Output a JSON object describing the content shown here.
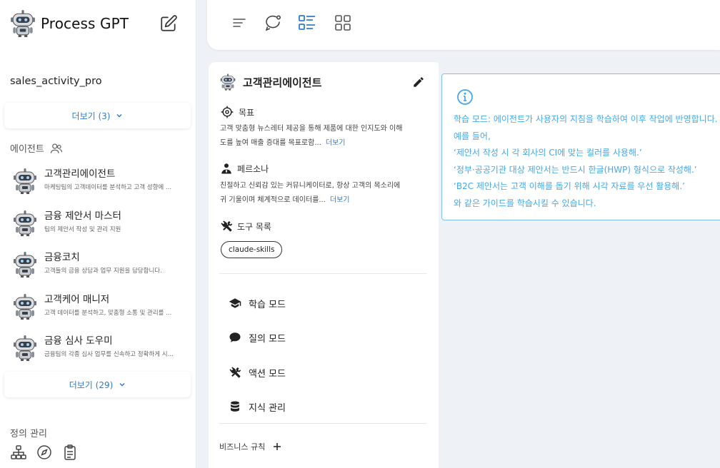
{
  "app": {
    "title": "Process GPT"
  },
  "sidebar": {
    "project_name": "sales_activity_pro",
    "more_projects": "더보기 (3)",
    "agents_label": "에이전트",
    "agents": [
      {
        "name": "고객관리에이전트",
        "desc": "마케팅팀의 고객데이터를 분석하고 고객 성향에 ..."
      },
      {
        "name": "금융 제안서 마스터",
        "desc": "팀의 제안서 작성 및 관리 지원"
      },
      {
        "name": "금융코치",
        "desc": "고객들의 금융 상담과 업무 지원을 담당합니다."
      },
      {
        "name": "고객케어 매니저",
        "desc": "고객 데이터를 분석하고, 맞춤형 소통 및 관리를 ..."
      },
      {
        "name": "금융 심사 도우미",
        "desc": "금융팀의 각종 심사 업무를 신속하고 정확하게 시..."
      }
    ],
    "more_agents": "더보기 (29)",
    "definition_label": "정의 관리"
  },
  "toolbar": {
    "icons": [
      "menu-icon",
      "chat-icon",
      "list-detail-icon",
      "grid-icon"
    ]
  },
  "agent_panel": {
    "title": "고객관리에이전트",
    "goal_label": "목표",
    "goal_line1": "고객 맞춤형 뉴스레터 제공을 통해 제품에 대한 인지도와 이해",
    "goal_line2": "도를 높여 매출 증대를 목표로함...",
    "goal_more": "더보기",
    "persona_label": "페르소나",
    "persona_line1": "친절하고 신뢰감 있는 커뮤니케이터로, 항상 고객의 목소리에",
    "persona_line2": "귀 기울이며 체계적으로 데이터를...",
    "persona_more": "더보기",
    "tools_label": "도구 목록",
    "tool_chip": "claude-skills",
    "modes": {
      "learn": "학습 모드",
      "query": "질의 모드",
      "action": "액션 모드",
      "knowledge": "지식 관리"
    },
    "business_rules": "비즈니스 규칙"
  },
  "info_card": {
    "lines": [
      "학습 모드: 에이전트가 사용자의 지침을 학습하여 이후 작업에 반영합니다.",
      "예를 들어,",
      "‘제안서 작성 시 각 회사의 CI에 맞는 컬러를 사용해.’",
      "‘정부·공공기관 대상 제안서는 반드시 한글(HWP) 형식으로 작성해.’",
      "‘B2C 제안서는 고객 이해를 돕기 위해 시각 자료를 우선 활용해.’",
      "와 같은 가이드를 학습시킬 수 있습니다."
    ]
  },
  "colors": {
    "accent": "#2f7dd1",
    "info": "#45a8ea",
    "info_border": "#7cc1ee",
    "background": "#eef1f5"
  }
}
